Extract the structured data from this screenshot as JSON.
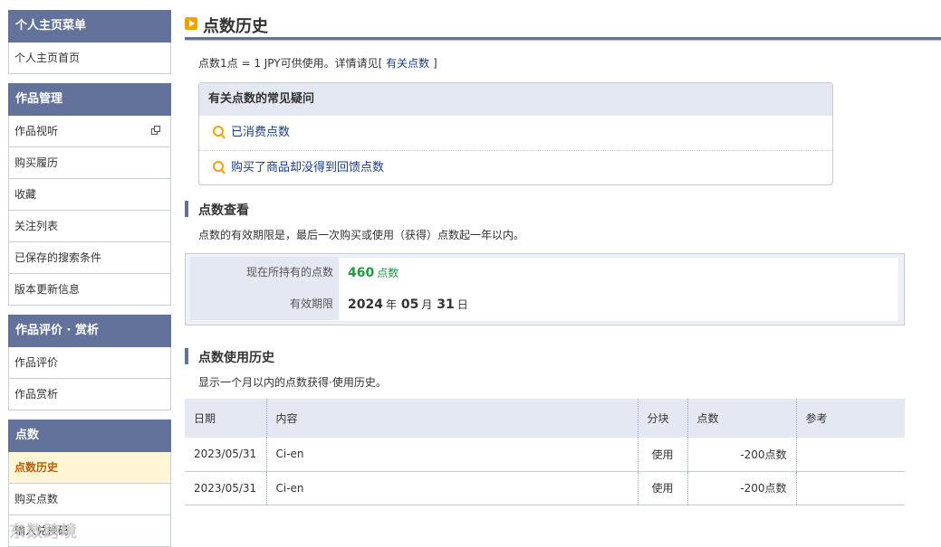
{
  "sidebar": {
    "groups": [
      {
        "title": "个人主页菜单",
        "items": [
          {
            "label": "个人主页首页"
          }
        ]
      },
      {
        "title": "作品管理",
        "items": [
          {
            "label": "作品视听"
          },
          {
            "label": "购买履历"
          },
          {
            "label": "收藏"
          },
          {
            "label": "关注列表"
          },
          {
            "label": "已保存的搜索条件"
          },
          {
            "label": "版本更新信息"
          }
        ]
      },
      {
        "title": "作品评价 · 赏析",
        "items": [
          {
            "label": "作品评价"
          },
          {
            "label": "作品赏析"
          }
        ]
      },
      {
        "title": "点数",
        "items": [
          {
            "label": "点数历史"
          },
          {
            "label": "购买点数"
          },
          {
            "label": "输入兑换码"
          }
        ]
      }
    ]
  },
  "page": {
    "title": "点数历史",
    "intro_text": "点数1点 = 1 JPY可供使用。详情请见[ ",
    "intro_link": "有关点数",
    "intro_end": " ]"
  },
  "faq": {
    "title": "有关点数的常见疑问",
    "items": [
      "已消费点数",
      "购买了商品却没得到回馈点数"
    ]
  },
  "points_check": {
    "title": "点数查看",
    "desc": "点数的有效期限是，最后一次购买或使用（获得）点数起一年以内。",
    "current_label": "现在所持有的点数",
    "current_value": "460",
    "current_unit": "点数",
    "expiry_label": "有效期限",
    "expiry_year": "2024",
    "year_unit": "年",
    "expiry_month": "05",
    "month_unit": "月",
    "expiry_day": "31",
    "day_unit": "日"
  },
  "history": {
    "title": "点数使用历史",
    "desc": "显示一个月以内的点数获得·使用历史。",
    "columns": [
      "日期",
      "内容",
      "分块",
      "点数",
      "参考"
    ],
    "rows": [
      {
        "date": "2023/05/31",
        "content": "Ci-en",
        "type": "使用",
        "points": "-200点数",
        "note": ""
      },
      {
        "date": "2023/05/31",
        "content": "Ci-en",
        "type": "使用",
        "points": "-200点数",
        "note": ""
      }
    ]
  },
  "watermark": "东数跨境",
  "colors": {
    "accent": "#62729a",
    "green": "#1f9a3e",
    "orange": "#f0a400",
    "link": "#1b3d8a"
  }
}
